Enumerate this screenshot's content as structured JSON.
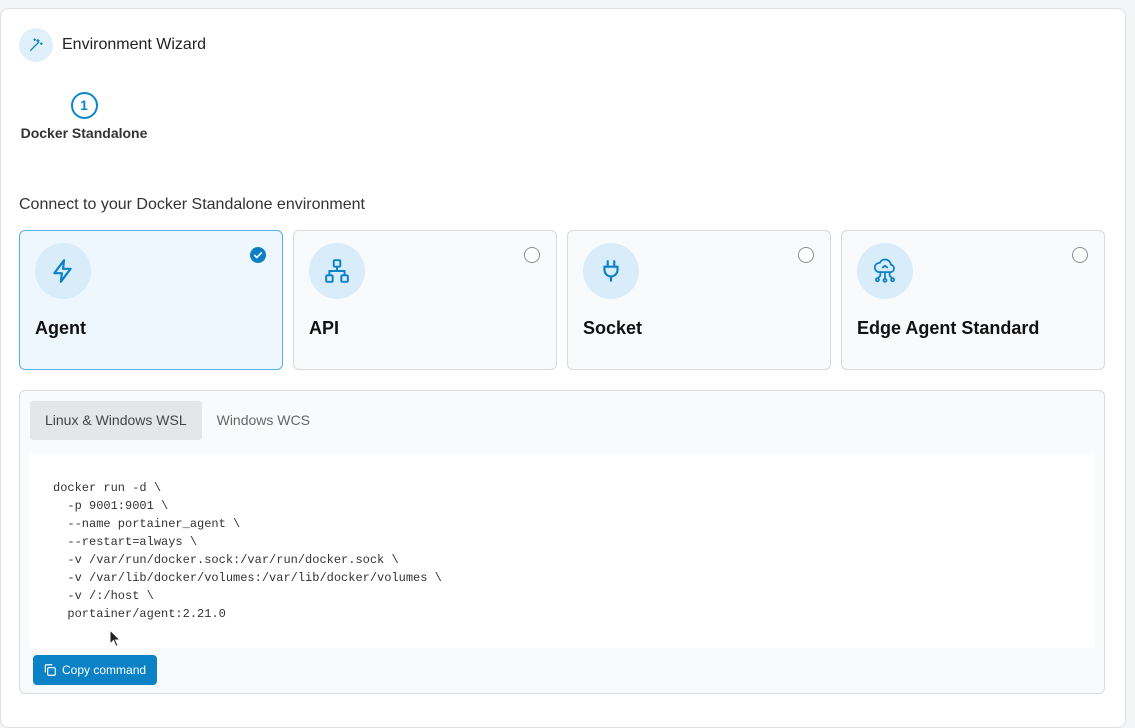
{
  "wizard": {
    "title": "Environment Wizard",
    "icon": "magic-wand-icon"
  },
  "stepper": {
    "steps": [
      {
        "number": "1",
        "label": "Docker Standalone"
      }
    ]
  },
  "section_title": "Connect to your Docker Standalone environment",
  "options": [
    {
      "label": "Agent",
      "icon": "lightning-icon",
      "selected": true
    },
    {
      "label": "API",
      "icon": "network-icon",
      "selected": false
    },
    {
      "label": "Socket",
      "icon": "plug-icon",
      "selected": false
    },
    {
      "label": "Edge Agent Standard",
      "icon": "cloud-icon",
      "selected": false
    }
  ],
  "command": {
    "tabs": [
      {
        "label": "Linux & Windows WSL",
        "active": true
      },
      {
        "label": "Windows WCS",
        "active": false
      }
    ],
    "code": "docker run -d \\\n  -p 9001:9001 \\\n  --name portainer_agent \\\n  --restart=always \\\n  -v /var/run/docker.sock:/var/run/docker.sock \\\n  -v /var/lib/docker/volumes:/var/lib/docker/volumes \\\n  -v /:/host \\\n  portainer/agent:2.21.0",
    "copy_label": "Copy command"
  },
  "colors": {
    "accent": "#0b82c6",
    "selected_bg": "#eef7fd",
    "icon_bg": "#d8ecfa"
  }
}
